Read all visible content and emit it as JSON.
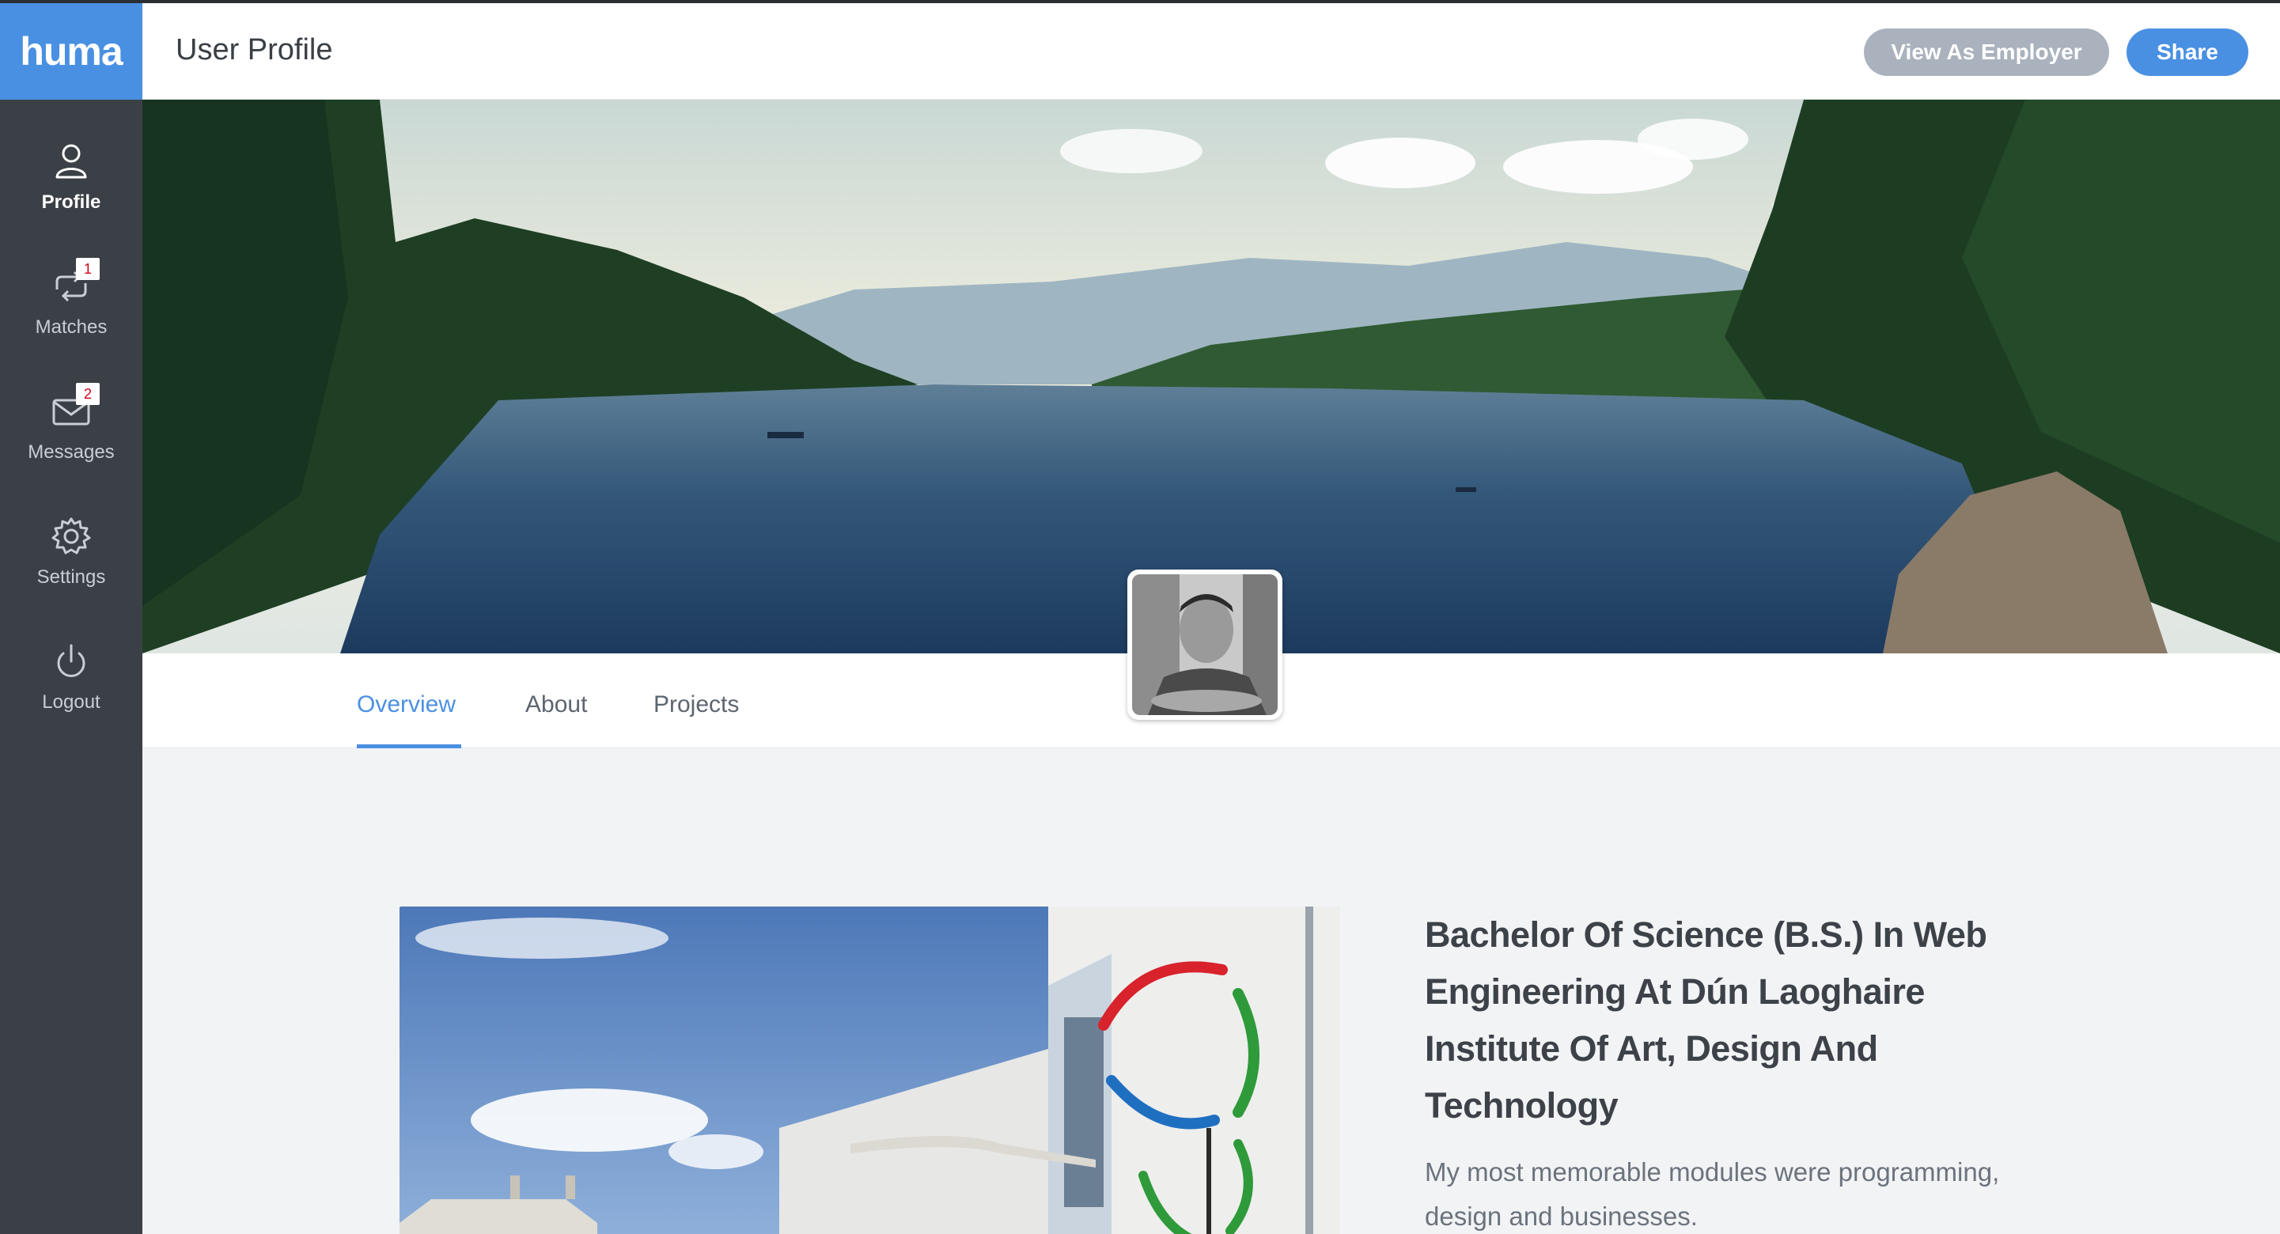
{
  "brand": {
    "logo": "huma",
    "accent": "#4a90e2"
  },
  "sidebar": {
    "items": [
      {
        "label": "Profile",
        "icon": "user-icon",
        "active": true
      },
      {
        "label": "Matches",
        "icon": "matches-icon",
        "badge": "1"
      },
      {
        "label": "Messages",
        "icon": "envelope-icon",
        "badge": "2"
      },
      {
        "label": "Settings",
        "icon": "gear-icon"
      },
      {
        "label": "Logout",
        "icon": "power-icon"
      }
    ]
  },
  "header": {
    "title": "User Profile",
    "view_as_employer": "View As Employer",
    "share": "Share"
  },
  "tabs": [
    {
      "label": "Overview",
      "active": true
    },
    {
      "label": "About"
    },
    {
      "label": "Projects"
    }
  ],
  "education": {
    "title": "Bachelor Of Science (B.S.) In Web Engineering At Dún Laoghaire Institute Of Art, Design And Technology",
    "description": "My most memorable modules were programming, design and businesses."
  }
}
